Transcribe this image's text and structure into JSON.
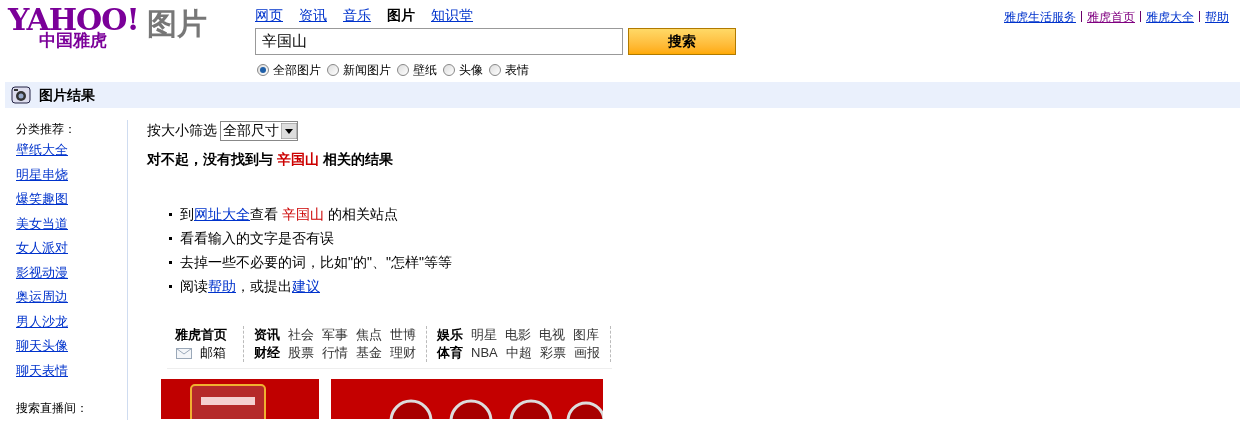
{
  "logo": {
    "brand": "YAHOO!",
    "brand_sub": "中国雅虎",
    "section": "图片"
  },
  "tabs": [
    {
      "label": "网页",
      "selected": false
    },
    {
      "label": "资讯",
      "selected": false
    },
    {
      "label": "音乐",
      "selected": false
    },
    {
      "label": "图片",
      "selected": true
    },
    {
      "label": "知识堂",
      "selected": false
    }
  ],
  "search": {
    "value": "辛国山",
    "button": "搜索"
  },
  "scopes": [
    {
      "label": "全部图片",
      "selected": true
    },
    {
      "label": "新闻图片",
      "selected": false
    },
    {
      "label": "壁纸",
      "selected": false
    },
    {
      "label": "头像",
      "selected": false
    },
    {
      "label": "表情",
      "selected": false
    }
  ],
  "top_links": [
    {
      "label": "雅虎生活服务",
      "visited": false
    },
    {
      "label": "雅虎首页",
      "visited": true
    },
    {
      "label": "雅虎大全",
      "visited": false
    },
    {
      "label": "帮助",
      "visited": false
    }
  ],
  "results_bar": {
    "title": "图片结果"
  },
  "sidebar": {
    "heading": "分类推荐：",
    "items": [
      "壁纸大全",
      "明星串烧",
      "爆笑趣图",
      "美女当道",
      "女人派对",
      "影视动漫",
      "奥运周边",
      "男人沙龙",
      "聊天头像",
      "聊天表情"
    ],
    "heading_2": "搜索直播间："
  },
  "filter": {
    "label": "按大小筛选",
    "value": "全部尺寸"
  },
  "no_result": [
    {
      "kind": "text",
      "text": "对不起，没有找到与 "
    },
    {
      "kind": "keyword",
      "text": "辛国山"
    },
    {
      "kind": "text",
      "text": " 相关的结果"
    }
  ],
  "hints": [
    [
      {
        "kind": "text",
        "text": "到"
      },
      {
        "kind": "link",
        "text": "网址大全"
      },
      {
        "kind": "text",
        "text": "查看 "
      },
      {
        "kind": "keyword",
        "text": "辛国山"
      },
      {
        "kind": "text",
        "text": " 的相关站点"
      }
    ],
    [
      {
        "kind": "text",
        "text": "看看输入的文字是否有误"
      }
    ],
    [
      {
        "kind": "text",
        "text": "去掉一些不必要的词，比如\"的\"、\"怎样\"等等"
      }
    ],
    [
      {
        "kind": "text",
        "text": "阅读"
      },
      {
        "kind": "link",
        "text": "帮助"
      },
      {
        "kind": "text",
        "text": "，或提出"
      },
      {
        "kind": "link",
        "text": "建议"
      }
    ]
  ],
  "portal_nav": {
    "home": "雅虎首页",
    "mail": "邮箱",
    "groups": [
      [
        {
          "head": "资讯",
          "items": [
            "社会",
            "军事",
            "焦点",
            "世博"
          ]
        },
        {
          "head": "财经",
          "items": [
            "股票",
            "行情",
            "基金",
            "理财"
          ]
        }
      ],
      [
        {
          "head": "娱乐",
          "items": [
            "明星",
            "电影",
            "电视",
            "图库"
          ]
        },
        {
          "head": "体育",
          "items": [
            "NBA",
            "中超",
            "彩票",
            "画报"
          ]
        }
      ]
    ]
  },
  "ads": [
    {
      "kind": "picture"
    },
    {
      "kind": "picture"
    }
  ]
}
